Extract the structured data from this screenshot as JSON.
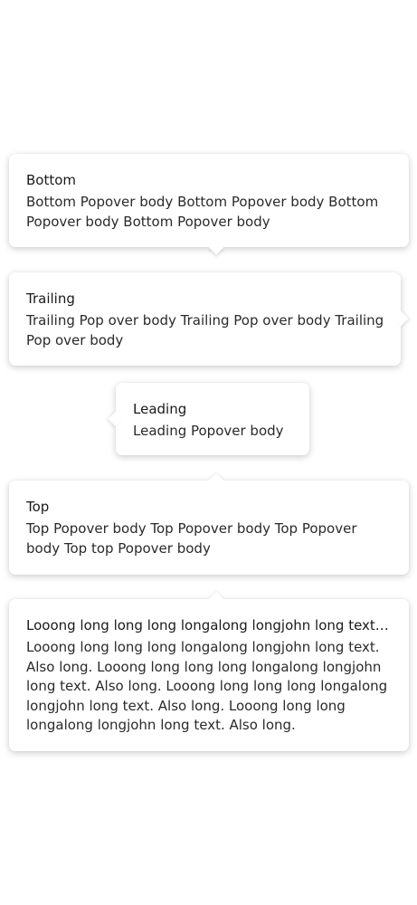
{
  "popovers": {
    "bottom": {
      "title": "Bottom",
      "body": "Bottom Popover body Bottom Popover body Bottom Popover body Bottom Popover body",
      "arrow": "bottom"
    },
    "trailing": {
      "title": "Trailing",
      "body": "Trailing Pop over body Trailing Pop over body Trailing Pop over body",
      "arrow": "trailing"
    },
    "leading": {
      "title": "Leading",
      "body": "Leading Popover body",
      "arrow": "leading"
    },
    "top": {
      "title": "Top",
      "body": "Top Popover body Top Popover body Top Popover body Top top Popover body",
      "arrow": "top"
    },
    "long": {
      "title": "Looong long long long longalong longjohn long text. Also long.",
      "body": "Looong long long long longalong longjohn long text. Also long. Looong long long long longalong longjohn long text. Also long. Looong long long long longalong longjohn long text. Also long. Looong long long longalong longjohn long text. Also long.",
      "arrow": "top"
    }
  },
  "colors": {
    "background": "#ffffff",
    "surface": "#ffffff",
    "title_text": "#1a1a1a",
    "body_text": "#2a2a2a"
  }
}
